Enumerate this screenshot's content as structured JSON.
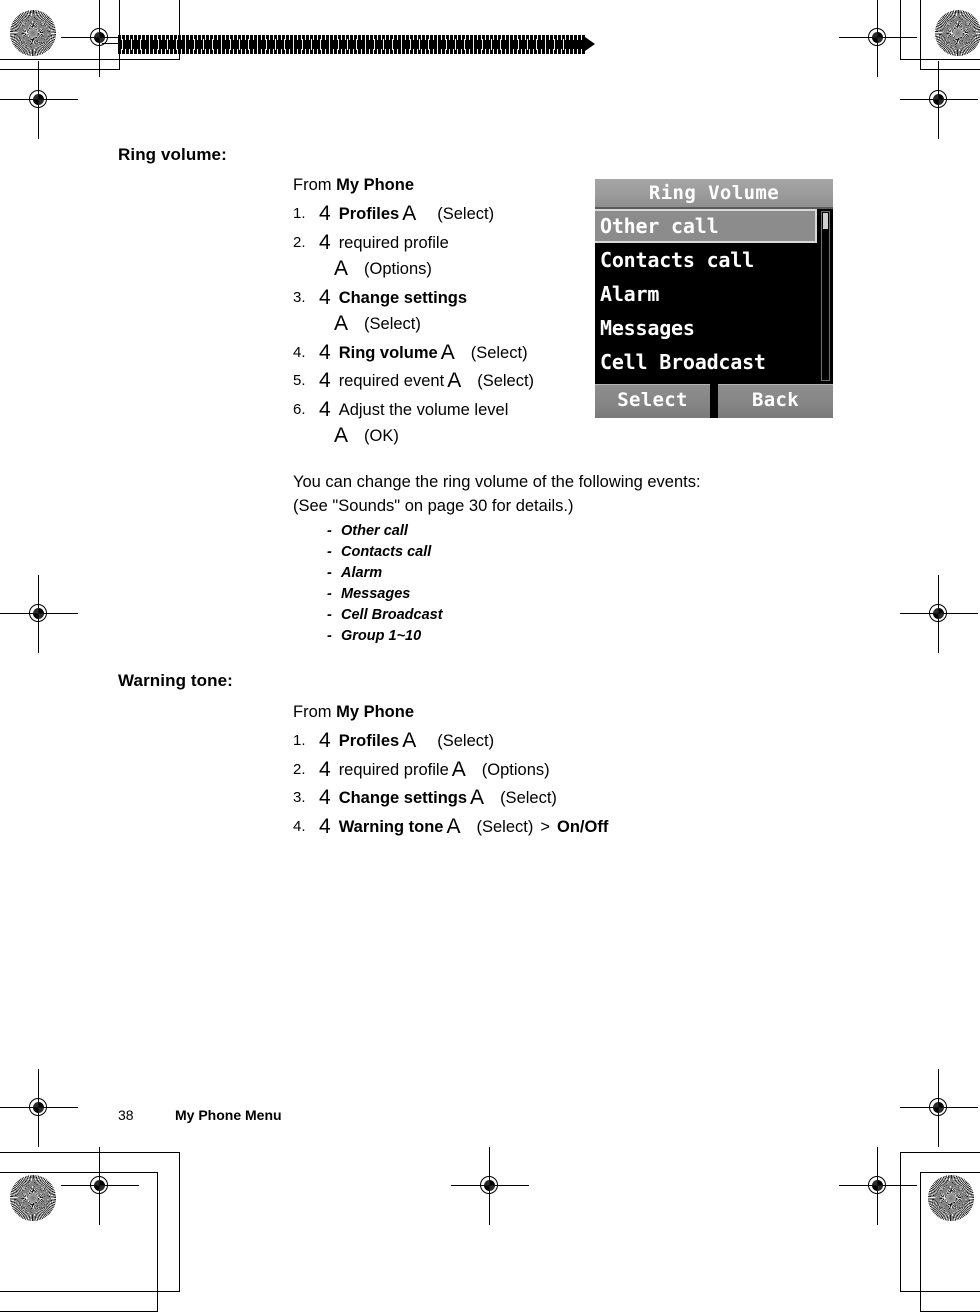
{
  "page": {
    "number": "38",
    "footer_title": "My Phone Menu"
  },
  "sections": [
    {
      "heading": "Ring volume:",
      "from_prefix": "From ",
      "from_target": "My Phone",
      "steps": [
        {
          "num": "1.",
          "nav": "4",
          "label": "Profiles",
          "key": "A",
          "action": "(Select)"
        },
        {
          "num": "2.",
          "nav": "4",
          "label": "required profile",
          "key": "A",
          "action": "(Options)"
        },
        {
          "num": "3.",
          "nav": "4",
          "label": "Change settings",
          "key": "A",
          "action": "(Select)"
        },
        {
          "num": "4.",
          "nav": "4",
          "label": "Ring volume",
          "key": "A",
          "action": "(Select)"
        },
        {
          "num": "5.",
          "nav": "4",
          "label": "required event",
          "key": "A",
          "action": "(Select)"
        },
        {
          "num": "6.",
          "nav": "4",
          "label": "Adjust the volume level",
          "key": "A",
          "action": "(OK)"
        }
      ],
      "paragraph_line1": "You can change the ring volume of the following events:",
      "paragraph_line2": "(See \"Sounds\" on page 30 for details.)",
      "events": [
        "Other call",
        "Contacts call",
        "Alarm",
        "Messages",
        "Cell Broadcast",
        "Group 1~10"
      ]
    },
    {
      "heading": "Warning tone:",
      "from_prefix": "From ",
      "from_target": "My Phone",
      "steps": [
        {
          "num": "1.",
          "nav": "4",
          "label": "Profiles",
          "key": "A",
          "action": "(Select)"
        },
        {
          "num": "2.",
          "nav": "4",
          "label": "required profile",
          "key": "A",
          "action": "(Options)"
        },
        {
          "num": "3.",
          "nav": "4",
          "label": "Change settings",
          "key": "A",
          "action": "(Select)"
        },
        {
          "num": "4.",
          "nav": "4",
          "label": "Warning tone",
          "key": "A",
          "action": "(Select)",
          "suffix_sep": ">",
          "suffix": "On/Off"
        }
      ]
    }
  ],
  "phone_screen": {
    "title": "Ring Volume",
    "items": [
      {
        "label": "Other call",
        "selected": true
      },
      {
        "label": "Contacts call",
        "selected": false
      },
      {
        "label": "Alarm",
        "selected": false
      },
      {
        "label": "Messages",
        "selected": false
      },
      {
        "label": "Cell Broadcast",
        "selected": false
      }
    ],
    "softkey_left": "Select",
    "softkey_right": "Back",
    "colors": {
      "background": "#000000",
      "title_bar": "#9b9b9b",
      "selected_row": "#8c8c8c",
      "text": "#ffffff",
      "softkey": "#858585"
    }
  }
}
